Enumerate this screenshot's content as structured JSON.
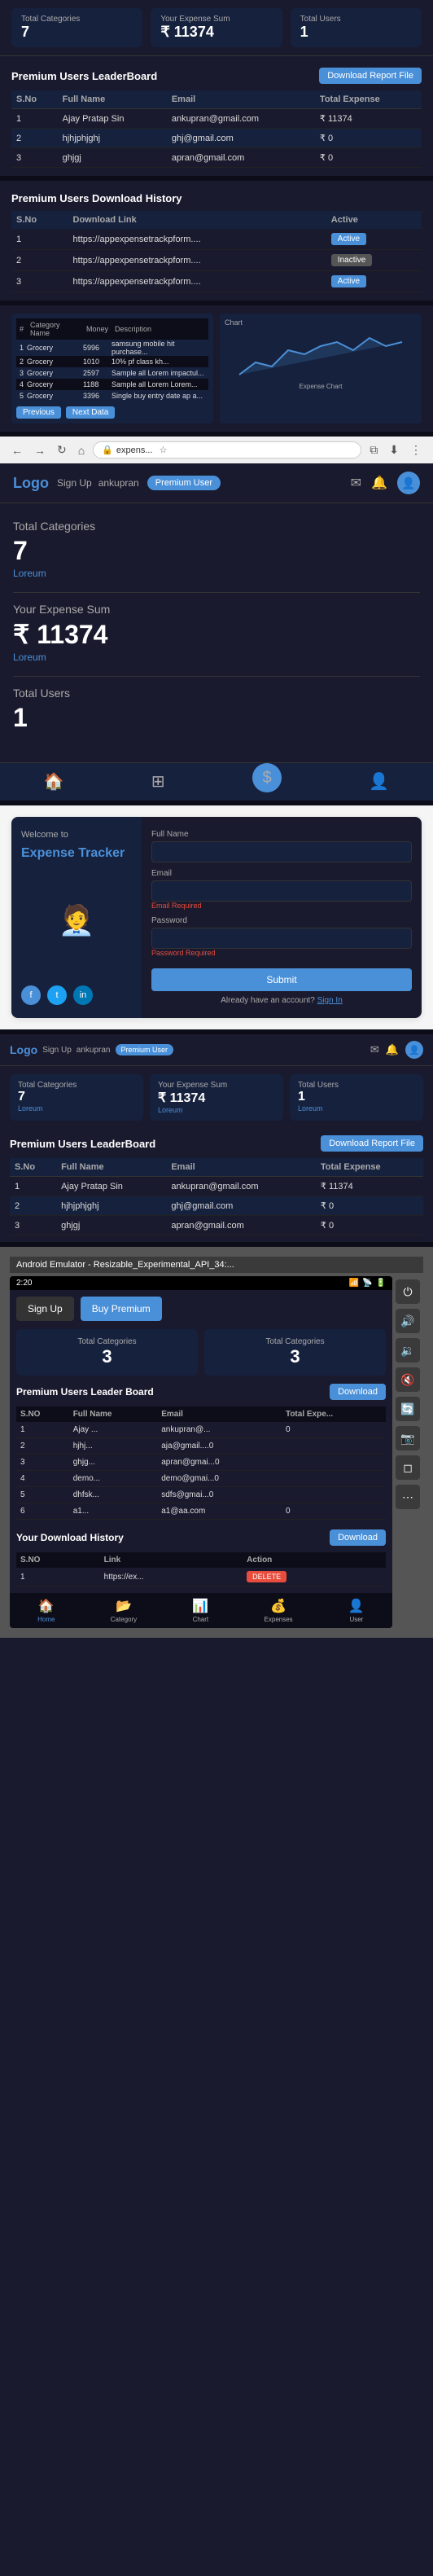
{
  "app": {
    "title": "Expense Tracker",
    "logo": "Logo",
    "nav": {
      "signup": "Sign Up",
      "username": "ankupran",
      "premium_badge": "Premium User"
    },
    "header_icons": {
      "notification": "🔔",
      "message": "✉",
      "avatar": "👤"
    }
  },
  "top_stats": {
    "total_categories": {
      "label": "Total Categories",
      "value": "7"
    },
    "expense_sum": {
      "label": "Your Expense Sum",
      "value": "₹ 11374"
    },
    "total_users": {
      "label": "Total Users",
      "value": "1"
    }
  },
  "leaderboard": {
    "title": "Premium Users LeaderBoard",
    "download_btn": "Download Report File",
    "columns": [
      "S.No",
      "Full Name",
      "Email",
      "Total Expense"
    ],
    "rows": [
      {
        "sno": "1",
        "name": "Ajay Pratap Sin",
        "email": "ankupran@gmail.com",
        "expense": "₹ 11374"
      },
      {
        "sno": "2",
        "name": "hjhjphjghj",
        "email": "ghj@gmail.com",
        "expense": "₹ 0"
      },
      {
        "sno": "3",
        "name": "ghjgj",
        "email": "apran@gmail.com",
        "expense": "₹ 0"
      }
    ]
  },
  "download_history": {
    "title": "Premium Users Download History",
    "columns": [
      "S.No",
      "Download Link",
      "Active"
    ],
    "rows": [
      {
        "sno": "1",
        "link": "https://appexpensetrackpform....",
        "active": true
      },
      {
        "sno": "2",
        "link": "https://appexpensetrackpform....",
        "active": false
      },
      {
        "sno": "3",
        "link": "https://appexpensetrackpform....",
        "active": true
      }
    ]
  },
  "browser": {
    "url": "expens...",
    "back": "←",
    "forward": "→",
    "refresh": "↻",
    "home": "⌂"
  },
  "main_view": {
    "stats": {
      "categories": {
        "label": "Total Categories",
        "value": "7",
        "sub": "Loreum"
      },
      "expense": {
        "label": "Your Expense Sum",
        "value": "₹ 11374",
        "sub": "Loreum"
      },
      "users": {
        "label": "Total Users",
        "value": "1"
      }
    }
  },
  "registration": {
    "title": "Welcome to",
    "subtitle": "Expense Tracker",
    "fields": {
      "full_name": {
        "label": "Full Name",
        "placeholder": ""
      },
      "email": {
        "label": "Email",
        "placeholder": "",
        "error": "Email Required"
      },
      "password": {
        "label": "Password",
        "placeholder": "",
        "error": "Password Required"
      }
    },
    "submit_btn": "Submit",
    "footer": "Already have an account?",
    "signin_link": "Sign In"
  },
  "emulator": {
    "window_title": "Android Emulator - Resizable_Experimental_API_34:...",
    "status_time": "2:20",
    "stat_cards": [
      {
        "label": "Total Categories",
        "value": "3"
      },
      {
        "label": "Total Categories",
        "value": "3"
      }
    ],
    "leaderboard": {
      "title": "Premium Users Leader Board",
      "download_btn": "Download",
      "columns": [
        "S.NO",
        "Full Name",
        "Email",
        "Total Expe..."
      ],
      "rows": [
        {
          "sno": "1",
          "name": "Ajay ...",
          "email": "ankupran@...",
          "expense": "0"
        },
        {
          "sno": "2",
          "name": "hjhj...",
          "email": "aja@gmail....0",
          "expense": ""
        },
        {
          "sno": "3",
          "name": "ghjg...",
          "email": "apran@gmai...0",
          "expense": ""
        },
        {
          "sno": "4",
          "name": "demo...",
          "email": "demo@gmai...0",
          "expense": ""
        },
        {
          "sno": "5",
          "name": "dhfsk...",
          "email": "sdfs@gmai...0",
          "expense": ""
        },
        {
          "sno": "6",
          "name": "a1...",
          "email": "a1@aa.com",
          "expense": "0"
        }
      ]
    },
    "download_history": {
      "title": "Your Download History",
      "download_btn": "Download",
      "columns": [
        "S.NO",
        "Link",
        "Action"
      ],
      "rows": [
        {
          "sno": "1",
          "link": "https://ex...",
          "action": "DELETE"
        }
      ]
    },
    "bottom_nav": [
      {
        "icon": "🏠",
        "label": "Home",
        "active": true
      },
      {
        "icon": "📂",
        "label": "Category",
        "active": false
      },
      {
        "icon": "📊",
        "label": "Chart",
        "active": false
      },
      {
        "icon": "💰",
        "label": "Expenses",
        "active": false
      },
      {
        "icon": "👤",
        "label": "User",
        "active": false
      }
    ],
    "side_controls": [
      "⏻",
      "🔊",
      "🔉",
      "🔇",
      "↩",
      "◻",
      "⋯"
    ]
  },
  "second_app_view": {
    "leaderboard": {
      "title": "Premium Users LeaderBoard",
      "download_btn": "Download Report File",
      "columns": [
        "S.No",
        "Full Name",
        "Email",
        "Total Expense"
      ],
      "rows": [
        {
          "sno": "1",
          "name": "Ajay Pratap Sin",
          "email": "ankupran@gmail.com",
          "expense": "₹ 11374"
        },
        {
          "sno": "2",
          "name": "hjhjphjghj",
          "email": "ghj@gmail.com",
          "expense": "₹ 0"
        },
        {
          "sno": "3",
          "name": "ghjgj",
          "email": "apran@gmail.com",
          "expense": "₹ 0"
        }
      ]
    }
  },
  "icons": {
    "home": "🏠",
    "grid": "⊞",
    "dollar": "$",
    "person": "👤",
    "bell": "🔔",
    "mail": "✉",
    "download": "⬇",
    "shield": "🛡",
    "camera": "📷",
    "rotate": "🔄",
    "volume": "🔊",
    "power": "⏻"
  }
}
